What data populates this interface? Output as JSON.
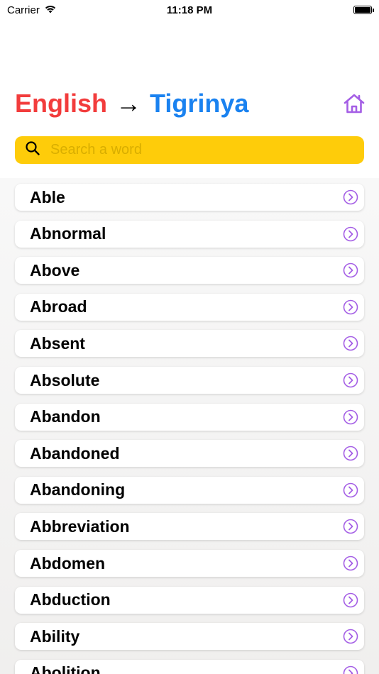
{
  "status_bar": {
    "carrier": "Carrier",
    "time": "11:18 PM"
  },
  "header": {
    "source_language": "English",
    "arrow": "→",
    "target_language": "Tigrinya",
    "home_icon": "house-icon"
  },
  "search": {
    "placeholder": "Search a word",
    "value": ""
  },
  "colors": {
    "source_language": "#f23c3c",
    "target_language": "#1a82f0",
    "search_background": "#fecc0a",
    "accent": "#a45ee5"
  },
  "words": [
    {
      "label": "Able"
    },
    {
      "label": "Abnormal"
    },
    {
      "label": "Above"
    },
    {
      "label": "Abroad"
    },
    {
      "label": "Absent"
    },
    {
      "label": "Absolute"
    },
    {
      "label": "Abandon"
    },
    {
      "label": "Abandoned"
    },
    {
      "label": "Abandoning"
    },
    {
      "label": "Abbreviation"
    },
    {
      "label": "Abdomen"
    },
    {
      "label": "Abduction"
    },
    {
      "label": "Ability"
    },
    {
      "label": "Abolition"
    }
  ]
}
